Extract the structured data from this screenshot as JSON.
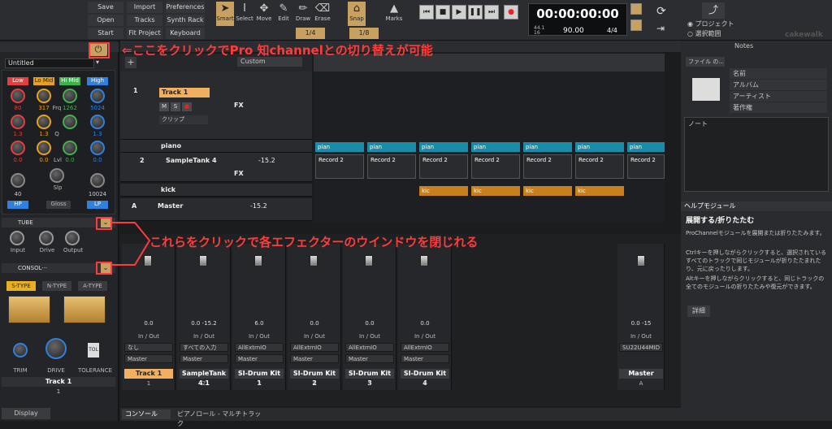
{
  "menu": {
    "save": "Save",
    "import": "Import",
    "preferences": "Preferences",
    "open": "Open",
    "tracks": "Tracks",
    "synthrack": "Synth Rack",
    "startscreen": "Start Screen",
    "fitproject": "Fit Project",
    "keyboard": "Keyboard"
  },
  "tools": {
    "smart": "Smart",
    "select": "Select",
    "move": "Move",
    "edit": "Edit",
    "draw": "Draw",
    "erase": "Erase",
    "snap": "Snap",
    "marks": "Marks",
    "snap_val": "1/4",
    "snap_val2": "1/8"
  },
  "transport": {
    "time": "00:00:00:00",
    "rate": "44.1",
    "bits": "16",
    "tempo": "90.00",
    "meter": "4/4",
    "project_opt": "プロジェクト",
    "selection_opt": "選択範囲"
  },
  "brand": "cakewalk",
  "prochannel": {
    "preset": "Untitled",
    "eq_bands": [
      "Low",
      "Lo Mid",
      "Hi Mid",
      "High"
    ],
    "eq_freq": [
      "80",
      "317",
      "1262",
      "5024"
    ],
    "eq_q": [
      "1.3",
      "1.3",
      "Q",
      "1.3"
    ],
    "freq_label": "Frq",
    "q_label": "Q",
    "lvl_label": "Lvl",
    "slp_label": "Slp",
    "hp": "HP",
    "lp": "LP",
    "gloss": "Gloss",
    "hp_val": "40",
    "lp_val": "10024",
    "tube": "TUBE",
    "input": "Input",
    "drive": "Drive",
    "output": "Output",
    "console": "CONSOL···",
    "stype": "S-TYPE",
    "ntype": "N-TYPE",
    "atype": "A-TYPE",
    "trim": "TRIM",
    "drive2": "DRIVE",
    "tolerance": "TOLERANCE",
    "tol": "TOL",
    "track": "Track 1",
    "num": "1",
    "display": "Display"
  },
  "tracks": {
    "custom": "Custom",
    "t1": "Track 1",
    "t1num": "1",
    "fx": "FX",
    "clip": "クリップ",
    "piano": "piano",
    "sampletank": "SampleTank 4",
    "t2num": "2",
    "t2vol": "-15.2",
    "kick": "kick",
    "master": "Master",
    "mvol": "-15.2",
    "a": "A"
  },
  "clips": {
    "pian": "pian",
    "record2": "Record 2",
    "kic": "kic"
  },
  "strips": [
    {
      "name": "Track 1",
      "num": "1",
      "io1": "なし",
      "io2": "Master",
      "vol": "0.0"
    },
    {
      "name": "SampleTank 4 1",
      "num": "2",
      "io1": "すべての入力",
      "io2": "Master",
      "vol": "0.0  -15.2"
    },
    {
      "name": "SI-Drum Kit 1",
      "num": "3",
      "io1": "AllExtrnIO",
      "io2": "Master",
      "vol": "6.0"
    },
    {
      "name": "SI-Drum Kit 2",
      "num": "4",
      "io1": "AllExtrnIO",
      "io2": "Master",
      "vol": "0.0"
    },
    {
      "name": "SI-Drum Kit 3",
      "num": "5",
      "io1": "AllExtrnIO",
      "io2": "Master",
      "vol": "0.0"
    },
    {
      "name": "SI-Drum Kit 4",
      "num": "6",
      "io1": "AllExtrnIO",
      "io2": "Master",
      "vol": "0.0"
    }
  ],
  "master_strip": {
    "name": "Master",
    "num": "A",
    "io": "SU22U44MID",
    "vol": "0.0  -15"
  },
  "inout": "In / Out",
  "tabs": {
    "console": "コンソール",
    "piano": "ピアノロール - マルチトラック"
  },
  "right": {
    "file": "ファイル の...",
    "notes": "Notes",
    "name": "名前",
    "album": "アルバム",
    "artist": "アーティスト",
    "copyright": "著作権",
    "note": "ノート",
    "help_title": "ヘルプモジュール",
    "help_head": "展開する/折りたたむ",
    "help_p1": "ProChannelモジュールを展開または折りたたみます。",
    "help_p2": "Ctrlキーを押しながらクリックすると、選択されているすべてのトラックで同じモジュールが折りたたまれたり、元に戻ったりします。",
    "help_p3": "Altキーを押しながらクリックすると、同じトラックの全てのモジュールの折りたたみや復元ができます。",
    "detail": "詳細"
  },
  "annotations": {
    "a1": "⇐ここをクリックでPro 知channelとの切り替えが可能",
    "a2": "これらをクリックで各エフェクターのウインドウを閉じれる"
  },
  "colors": {
    "accent": "#ff3b3b",
    "clip_blue": "#1a8ca8",
    "clip_orange": "#c8801a",
    "track_name": "#f0b060"
  }
}
